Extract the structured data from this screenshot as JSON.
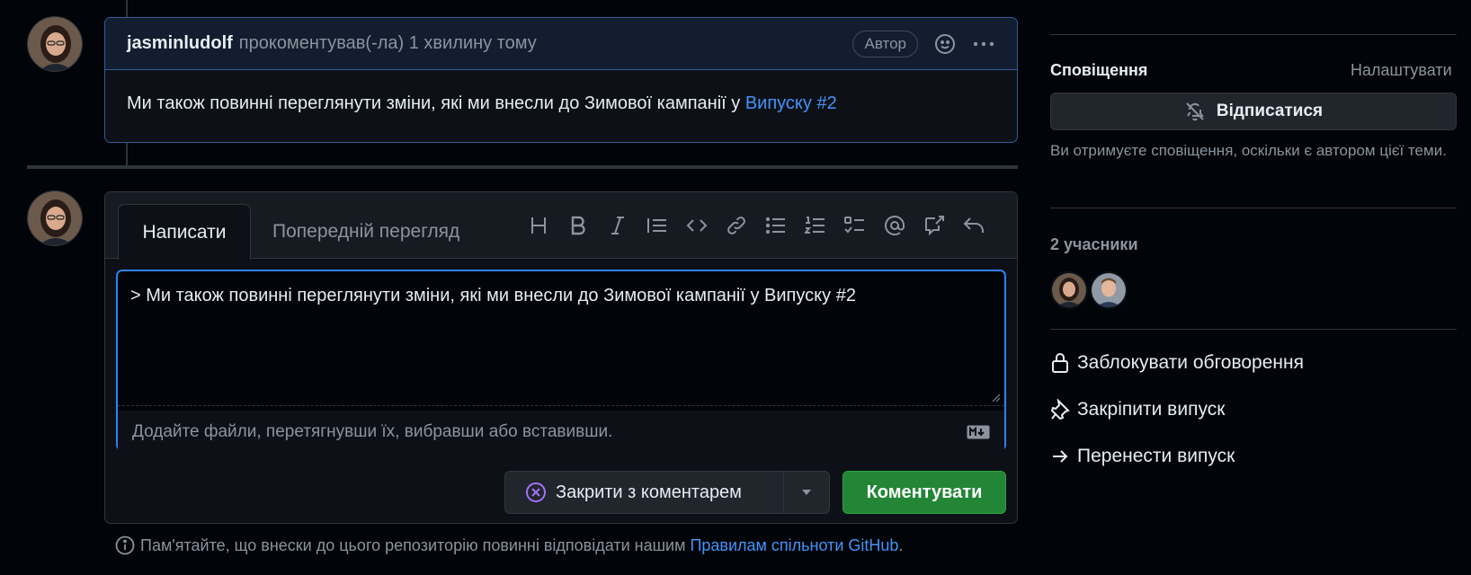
{
  "comment": {
    "author": "jasminludolf",
    "meta": "прокоментував(-ла) 1 хвилину тому",
    "badge": "Автор",
    "body_text": "Ми також повинні переглянути зміни, які ми внесли до Зимової кампанії у ",
    "body_link": "Випуску #2"
  },
  "editor": {
    "tab_write": "Написати",
    "tab_preview": "Попередній перегляд",
    "toolbar": [
      "heading-icon",
      "bold-icon",
      "italic-icon",
      "quote-icon",
      "code-icon",
      "link-icon",
      "unordered-list-icon",
      "ordered-list-icon",
      "task-list-icon",
      "mention-icon",
      "reference-icon",
      "undo-icon"
    ],
    "text_value": "> Ми також повинні переглянути зміни, які ми внесли до Зимової кампанії у Випуску #2",
    "attach_hint": "Додайте файли, перетягнувши їх, вибравши або вставивши.",
    "close_label": "Закрити з коментарем",
    "comment_label": "Коментувати"
  },
  "guideline": {
    "text": "Пам'ятайте, що внески до цього репозиторію повинні відповідати нашим ",
    "link": "Правилам спільноти GitHub",
    "end": "."
  },
  "sidebar": {
    "notifications_title": "Сповіщення",
    "customize": "Налаштувати",
    "unsubscribe": "Відписатися",
    "note": "Ви отримуєте сповіщення, оскільки є автором цієї теми.",
    "participants_title": "2 учасники",
    "lock": "Заблокувати обговорення",
    "pin": "Закріпити випуск",
    "transfer": "Перенести випуск"
  },
  "colors": {
    "accent": "#4493f8",
    "primary_button": "#238636",
    "close_icon": "#a371f7"
  }
}
